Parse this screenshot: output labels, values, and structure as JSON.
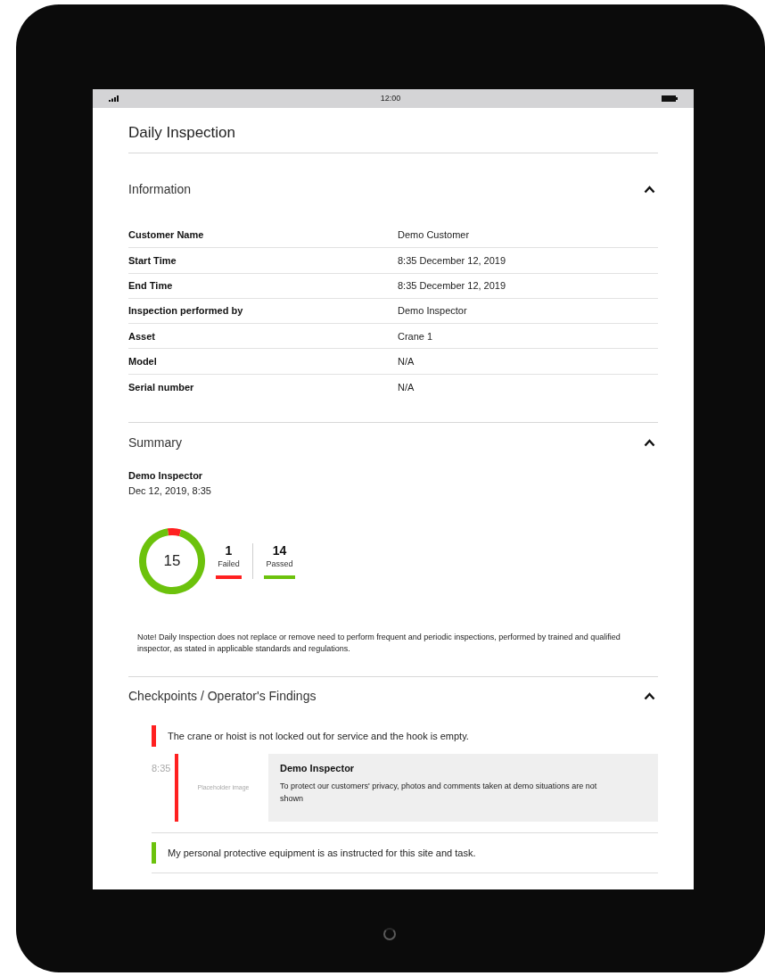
{
  "status_bar": {
    "time": "12:00"
  },
  "title": "Daily Inspection",
  "information": {
    "heading": "Information",
    "expanded": true,
    "rows": [
      {
        "label": "Customer Name",
        "value": "Demo Customer"
      },
      {
        "label": "Start Time",
        "value": "8:35 December 12, 2019"
      },
      {
        "label": "End Time",
        "value": "8:35 December 12, 2019"
      },
      {
        "label": "Inspection performed by",
        "value": "Demo Inspector"
      },
      {
        "label": "Asset",
        "value": "Crane 1"
      },
      {
        "label": "Model",
        "value": "N/A"
      },
      {
        "label": "Serial number",
        "value": "N/A"
      }
    ]
  },
  "summary": {
    "heading": "Summary",
    "expanded": true,
    "inspector": "Demo Inspector",
    "date": "Dec 12, 2019, 8:35",
    "total": "15",
    "stats": [
      {
        "count": "1",
        "label": "Failed",
        "color": "#ff2020"
      },
      {
        "count": "14",
        "label": "Passed",
        "color": "#6cc20c"
      }
    ],
    "note": "Note! Daily Inspection does not replace or remove need to perform frequent and periodic inspections, performed by trained and qualified inspector, as stated in applicable standards and regulations."
  },
  "checkpoints": {
    "heading": "Checkpoints / Operator's Findings",
    "expanded": true,
    "items": [
      {
        "text": "The crane or hoist is not locked out for service and the hook is empty.",
        "color": "#ff2020",
        "finding": {
          "time": "8:35",
          "image_label": "Placeholder image",
          "author": "Demo Inspector",
          "comment": "To protect our customers' privacy, photos and comments taken at demo situations are not shown"
        }
      },
      {
        "text": "My personal protective equipment is as instructed for this site and task.",
        "color": "#6cc20c"
      }
    ]
  }
}
